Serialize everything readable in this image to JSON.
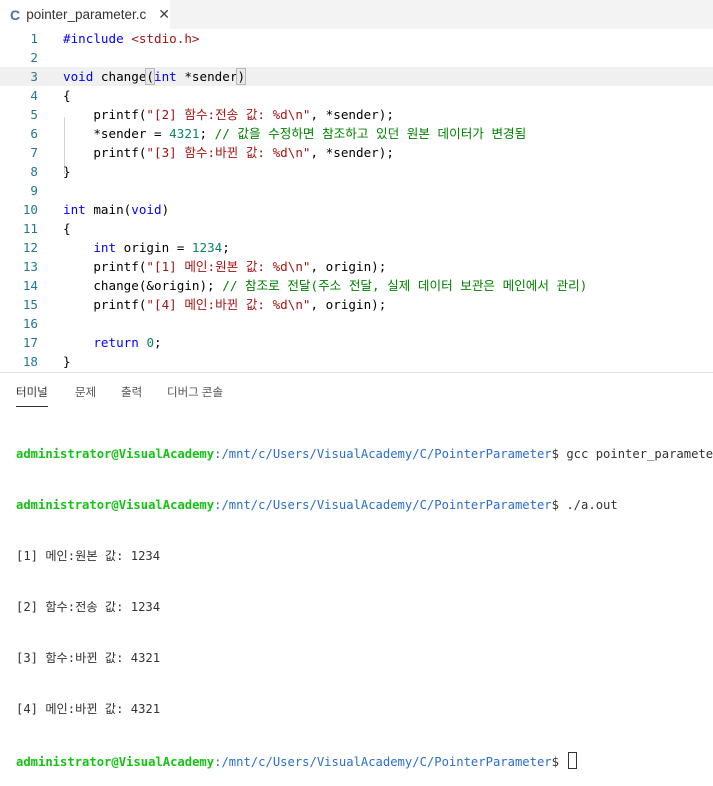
{
  "tab": {
    "icon": "c-language-icon",
    "icon_text": "C",
    "filename": "pointer_parameter.c",
    "close": "✕"
  },
  "code_lines": [
    [
      [
        "pp",
        "#include "
      ],
      [
        "inc",
        "<stdio.h>"
      ]
    ],
    [],
    [
      [
        "kw",
        "void"
      ],
      [
        "id",
        " change"
      ],
      [
        "br",
        "("
      ],
      [
        "kw",
        "int"
      ],
      [
        "id",
        " *sender"
      ],
      [
        "br",
        ")"
      ]
    ],
    [
      [
        "id",
        "{"
      ]
    ],
    [
      [
        "id",
        "    printf("
      ],
      [
        "str",
        "\"[2] 함수:전송 값: %d\\n\""
      ],
      [
        "id",
        ", *sender);"
      ]
    ],
    [
      [
        "id",
        "    *sender = "
      ],
      [
        "num",
        "4321"
      ],
      [
        "id",
        "; "
      ],
      [
        "cm",
        "// 값을 수정하면 참조하고 있던 원본 데이터가 변경됨"
      ]
    ],
    [
      [
        "id",
        "    printf("
      ],
      [
        "str",
        "\"[3] 함수:바뀐 값: %d\\n\""
      ],
      [
        "id",
        ", *sender);"
      ]
    ],
    [
      [
        "id",
        "}"
      ]
    ],
    [],
    [
      [
        "kw",
        "int"
      ],
      [
        "id",
        " main("
      ],
      [
        "kw",
        "void"
      ],
      [
        "id",
        ")"
      ]
    ],
    [
      [
        "id",
        "{"
      ]
    ],
    [
      [
        "id",
        "    "
      ],
      [
        "kw",
        "int"
      ],
      [
        "id",
        " origin = "
      ],
      [
        "num",
        "1234"
      ],
      [
        "id",
        ";"
      ]
    ],
    [
      [
        "id",
        "    printf("
      ],
      [
        "str",
        "\"[1] 메인:원본 값: %d\\n\""
      ],
      [
        "id",
        ", origin);"
      ]
    ],
    [
      [
        "id",
        "    change(&origin); "
      ],
      [
        "cm",
        "// 참조로 전달(주소 전달, 실제 데이터 보관은 메인에서 관리)"
      ]
    ],
    [
      [
        "id",
        "    printf("
      ],
      [
        "str",
        "\"[4] 메인:바뀐 값: %d\\n\""
      ],
      [
        "id",
        ", origin);"
      ]
    ],
    [],
    [
      [
        "id",
        "    "
      ],
      [
        "kw",
        "return"
      ],
      [
        "id",
        " "
      ],
      [
        "num",
        "0"
      ],
      [
        "id",
        ";"
      ]
    ],
    [
      [
        "id",
        "}"
      ]
    ]
  ],
  "panel_tabs": [
    "터미널",
    "문제",
    "출력",
    "디버그 콘솔"
  ],
  "terminal": {
    "user": "administrator@VisualAcademy",
    "path": ":/mnt/c/Users/VisualAcademy/C/PointerParameter",
    "prompt": "$ ",
    "commands": [
      "gcc pointer_parameter.c",
      "./a.out",
      ""
    ],
    "output": [
      "[1] 메인:원본 값: 1234",
      "[2] 함수:전송 값: 1234",
      "[3] 함수:바뀐 값: 4321",
      "[4] 메인:바뀐 값: 4321"
    ]
  }
}
